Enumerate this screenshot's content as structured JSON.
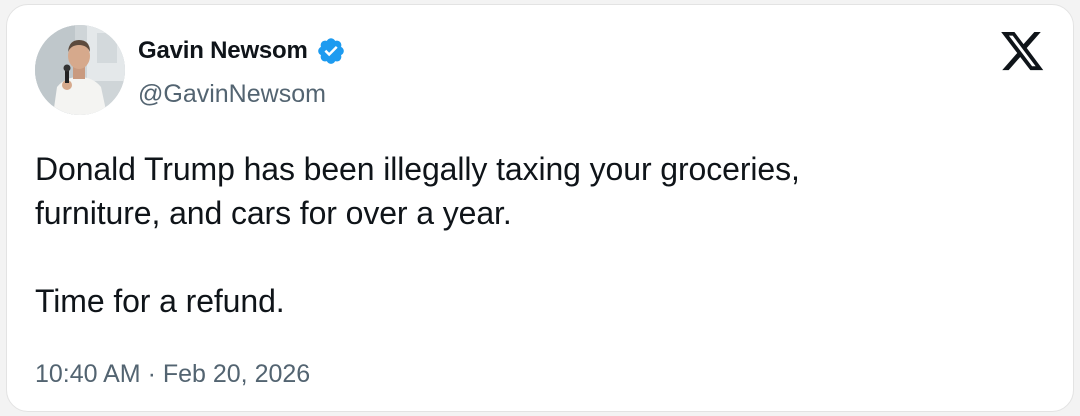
{
  "author": {
    "name": "Gavin Newsom",
    "handle": "@GavinNewsom",
    "verified": true,
    "avatar_icon": "profile-photo"
  },
  "tweet": {
    "lines": [
      "Donald Trump has been illegally taxing your groceries,",
      "furniture, and cars for over a year.",
      "",
      "Time for a refund."
    ],
    "timestamp": "10:40 AM · Feb 20, 2026"
  },
  "brand": {
    "logo_icon": "x-logo-icon",
    "verified_color": "#1d9bf0",
    "text_color": "#0f1419",
    "secondary_color": "#536471"
  }
}
